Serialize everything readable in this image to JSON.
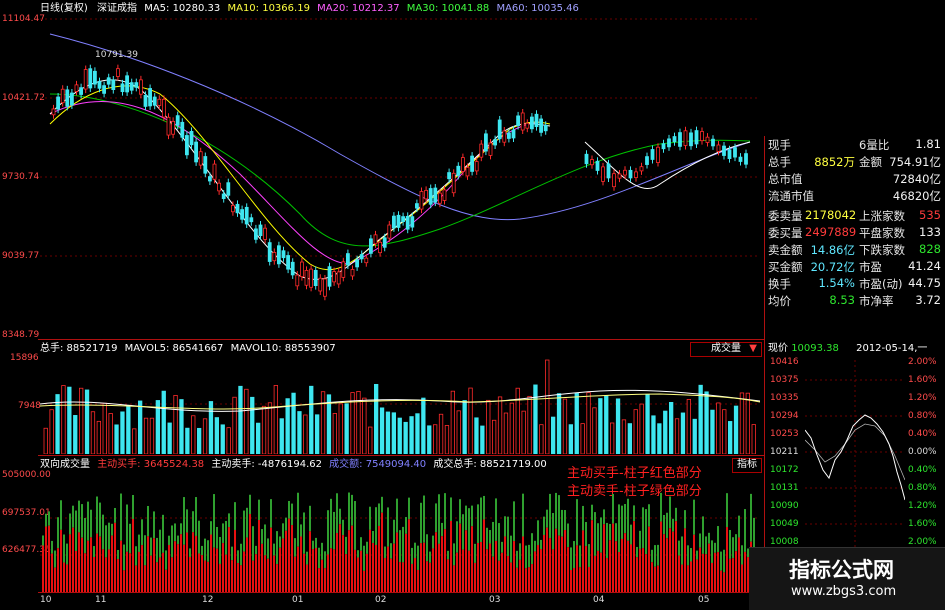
{
  "header": {
    "period": "日线(复权)",
    "index_name": "深证成指",
    "ma5": "MA5: 10280.33",
    "ma10": "MA10: 10366.19",
    "ma20": "MA20: 10212.37",
    "ma30": "MA30: 10041.88",
    "ma60": "MA60: 10035.46"
  },
  "price_axis": [
    "11104.47",
    "10421.72",
    "9730.74",
    "9039.77",
    "8348.79"
  ],
  "peak_label": "10791.39",
  "volume": {
    "title": "总手: 88521719",
    "mavol5": "MAVOL5: 86541667",
    "mavol10": "MAVOL10: 88553907",
    "axis": [
      "15896",
      "7948"
    ],
    "dropdown": "成交量"
  },
  "flow": {
    "title": "双向成交量",
    "buy": "主动买手: 3645524.38",
    "sell": "主动卖手: -4876194.62",
    "neutral": "成交额: 7549094.40",
    "total": "成交总手: 88521719.00",
    "button": "指标",
    "axis": [
      "505000.00",
      "697537.01",
      "626477.36"
    ],
    "annot1": "主动买手-柱子红色部分",
    "annot2": "主动卖手-柱子绿色部分"
  },
  "x_axis": [
    "10",
    "11",
    "12",
    "01",
    "02",
    "03",
    "04",
    "05"
  ],
  "info_panel": {
    "rows": [
      {
        "k1": "现手",
        "v1": "",
        "k2": "6量比",
        "v2": "1.81"
      },
      {
        "k1": "总手",
        "v1": "8852万",
        "k2": "金额",
        "v2": "754.91亿"
      },
      {
        "k1": "总市值",
        "v1": "",
        "k2": "",
        "v2": "72840亿"
      },
      {
        "k1": "流通市值",
        "v1": "",
        "k2": "",
        "v2": "46820亿"
      },
      {
        "k1": "委卖量",
        "v1": "2178042",
        "k2": "上涨家数",
        "v2": "535"
      },
      {
        "k1": "委买量",
        "v1": "2497889",
        "k2": "平盘家数",
        "v2": "133"
      },
      {
        "k1": "卖金额",
        "v1": "14.86亿",
        "k2": "下跌家数",
        "v2": "828"
      },
      {
        "k1": "买金额",
        "v1": "20.72亿",
        "k2": "市盈",
        "v2": "41.24"
      },
      {
        "k1": "换手",
        "v1": "1.54%",
        "k2": "市盈(动)",
        "v2": "44.75"
      },
      {
        "k1": "均价",
        "v1": "8.53",
        "k2": "市净率",
        "v2": "3.72"
      }
    ]
  },
  "mini_chart": {
    "price": "现价",
    "price_value": "10093.38",
    "date": "2012-05-14,一",
    "left_axis": [
      "10416",
      "10375",
      "10335",
      "10294",
      "10253",
      "10211",
      "10172",
      "10131",
      "10090",
      "10049",
      "10008"
    ],
    "right_axis": [
      "2.00%",
      "1.60%",
      "1.20%",
      "0.80%",
      "0.40%",
      "0.00%",
      "0.40%",
      "0.80%",
      "1.20%",
      "1.60%",
      "2.00%"
    ]
  },
  "watermark": {
    "line1": "指标公式网",
    "line2": "www.zbgs3.com"
  },
  "colors": {
    "up": "#ff2b2b",
    "down": "#3ee6f0",
    "green_bar": "#2fa02f",
    "ma5": "#ffffff",
    "ma10": "#ffff00",
    "ma20": "#ff40ff",
    "ma30": "#00ff00",
    "ma60": "#8080ff"
  }
}
